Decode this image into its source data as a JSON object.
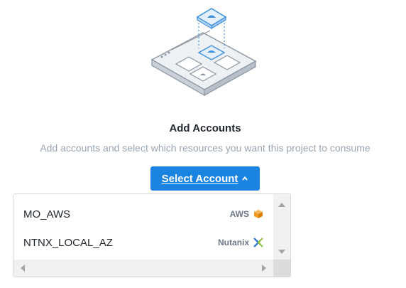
{
  "header": {
    "title": "Add Accounts",
    "subtitle": "Add accounts and select which resources you want this project to consume"
  },
  "illustration": {
    "icon": "accounts-illustration"
  },
  "select_button": {
    "label": "Select Account",
    "icon": "chevron-up-icon",
    "color": "#1b83e0"
  },
  "accounts": [
    {
      "name": "MO_AWS",
      "provider": "AWS",
      "icon": "aws-cube-icon",
      "icon_color": "#f19a1f"
    },
    {
      "name": "NTNX_LOCAL_AZ",
      "provider": "Nutanix",
      "icon": "nutanix-x-icon",
      "icon_color": "#1b6fd1"
    }
  ]
}
